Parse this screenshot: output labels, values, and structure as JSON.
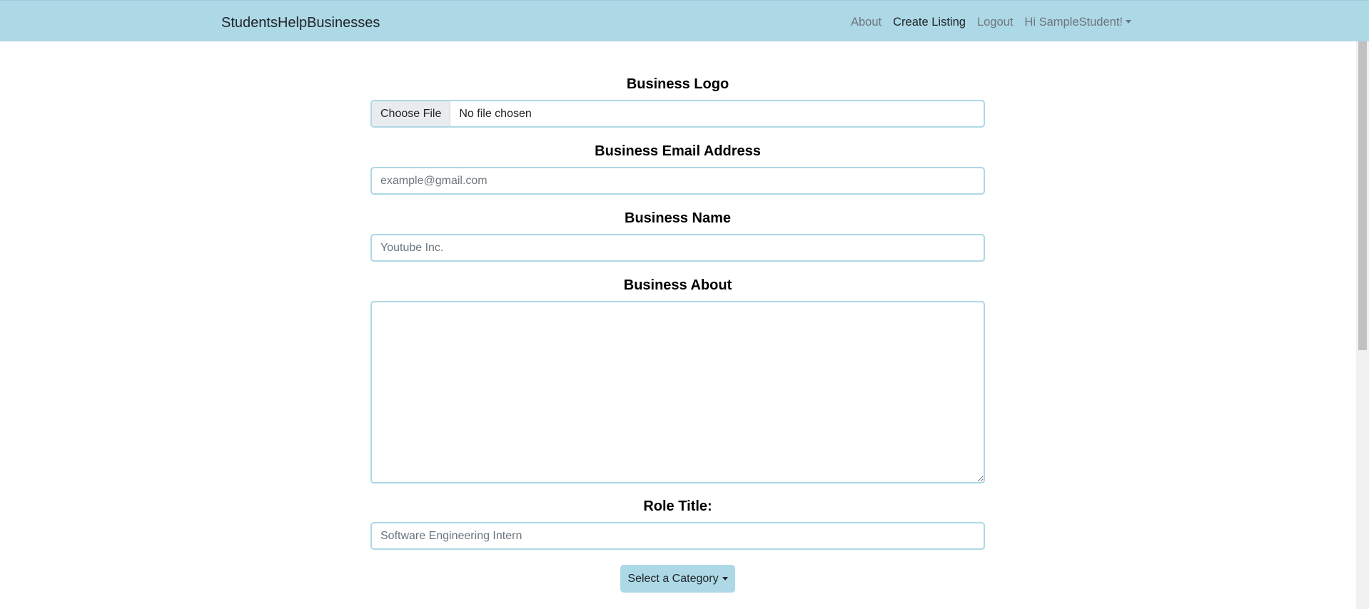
{
  "navbar": {
    "brand": "StudentsHelpBusinesses",
    "links": [
      {
        "label": "About"
      },
      {
        "label": "Create Listing"
      },
      {
        "label": "Logout"
      }
    ],
    "user_menu_label": "Hi SampleStudent!"
  },
  "form": {
    "logo": {
      "label": "Business Logo",
      "button_label": "Choose File",
      "status": "No file chosen"
    },
    "email": {
      "label": "Business Email Address",
      "placeholder": "example@gmail.com"
    },
    "name": {
      "label": "Business Name",
      "placeholder": "Youtube Inc."
    },
    "about": {
      "label": "Business About"
    },
    "role": {
      "label": "Role Title:",
      "placeholder": "Software Engineering Intern"
    },
    "category_button_label": "Select a Category"
  },
  "colors": {
    "accent": "#add8e6",
    "text": "#212529",
    "muted": "#6c757d"
  }
}
